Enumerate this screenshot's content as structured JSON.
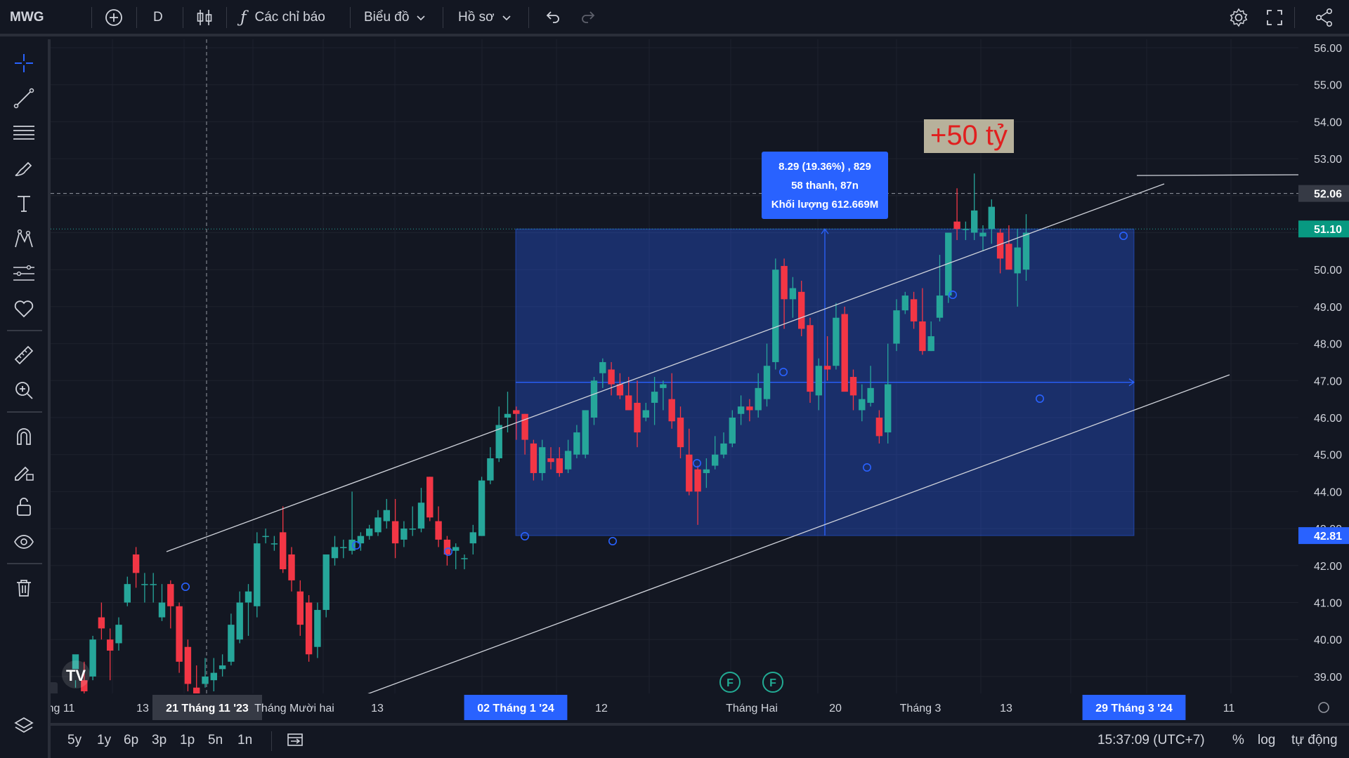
{
  "topbar": {
    "symbol": "MWG",
    "interval": "D",
    "indicators_label": "Các chỉ báo",
    "chart_menu_label": "Biểu đồ",
    "profile_menu_label": "Hồ sơ"
  },
  "chart_data": {
    "type": "candlestick",
    "ylim": [
      38.6,
      56.4
    ],
    "y_ticks": [
      "56.00",
      "55.00",
      "54.00",
      "53.00",
      "52.00",
      "51.00",
      "50.00",
      "49.00",
      "48.00",
      "47.00",
      "46.00",
      "45.00",
      "44.00",
      "43.00",
      "42.00",
      "41.00",
      "40.00",
      "39.00"
    ],
    "price_badges": {
      "crosshair": "52.06",
      "last": "51.10",
      "range_low": "42.81"
    },
    "x_labels": [
      {
        "text": "ng 11",
        "highlight": false
      },
      {
        "text": "13",
        "highlight": false
      },
      {
        "text": "21 Tháng 11 '23",
        "highlight": "gray"
      },
      {
        "text": "Tháng Mười hai",
        "highlight": false
      },
      {
        "text": "13",
        "highlight": false
      },
      {
        "text": "02 Tháng 1 '24",
        "highlight": "blue"
      },
      {
        "text": "12",
        "highlight": false
      },
      {
        "text": "Tháng Hai",
        "highlight": false
      },
      {
        "text": "20",
        "highlight": false
      },
      {
        "text": "Tháng 3",
        "highlight": false
      },
      {
        "text": "13",
        "highlight": false
      },
      {
        "text": "29 Tháng 3 '24",
        "highlight": "blue"
      },
      {
        "text": "11",
        "highlight": false
      }
    ],
    "measure_tooltip": [
      "8.29 (19.36%) , 829",
      "58 thanh, 87n",
      "Khối lượng 612.669M"
    ],
    "annotation_text": "+50 tỷ",
    "events": [
      "F",
      "F"
    ],
    "candles": [
      [
        39.2,
        39.6,
        38.9,
        38.7
      ],
      [
        38.9,
        38.6,
        39.4,
        38.4
      ],
      [
        39.0,
        40.0,
        40.1,
        38.9
      ],
      [
        40.6,
        40.3,
        41.0,
        40.0
      ],
      [
        40.0,
        39.7,
        40.3,
        38.9
      ],
      [
        39.9,
        40.4,
        40.6,
        39.7
      ],
      [
        41.0,
        41.5,
        41.7,
        40.9
      ],
      [
        42.3,
        41.8,
        42.5,
        41.4
      ],
      [
        41.5,
        41.5,
        41.8,
        41.0
      ],
      [
        41.5,
        41.5,
        41.8,
        41.0
      ],
      [
        40.6,
        41.0,
        41.5,
        40.5
      ],
      [
        41.5,
        40.9,
        41.6,
        40.3
      ],
      [
        40.9,
        39.4,
        41.0,
        39.1
      ],
      [
        39.8,
        38.8,
        40.0,
        38.6
      ],
      [
        38.7,
        38.3,
        39.3,
        38.0
      ],
      [
        38.8,
        39.0,
        39.5,
        38.7
      ],
      [
        38.9,
        39.1,
        39.5,
        38.6
      ],
      [
        39.2,
        39.3,
        39.6,
        39.0
      ],
      [
        39.4,
        40.4,
        40.7,
        39.3
      ],
      [
        40.0,
        41.0,
        41.3,
        39.9
      ],
      [
        41.0,
        41.3,
        41.5,
        40.1
      ],
      [
        40.9,
        42.6,
        42.9,
        40.6
      ],
      [
        42.8,
        42.8,
        43.0,
        42.6
      ],
      [
        42.6,
        42.6,
        42.8,
        42.4
      ],
      [
        42.9,
        41.9,
        43.6,
        41.8
      ],
      [
        42.3,
        41.6,
        42.5,
        41.3
      ],
      [
        41.3,
        40.4,
        41.6,
        40.1
      ],
      [
        41.0,
        39.6,
        41.2,
        39.4
      ],
      [
        39.8,
        40.8,
        41.0,
        39.5
      ],
      [
        40.8,
        42.3,
        42.3,
        40.6
      ],
      [
        42.2,
        42.5,
        42.8,
        42.0
      ],
      [
        42.5,
        42.5,
        42.7,
        42.2
      ],
      [
        42.4,
        42.7,
        44.0,
        42.3
      ],
      [
        42.6,
        42.8,
        42.9,
        42.4
      ],
      [
        42.8,
        43.0,
        43.1,
        42.7
      ],
      [
        42.9,
        43.3,
        43.5,
        42.8
      ],
      [
        43.2,
        43.5,
        43.8,
        43.0
      ],
      [
        43.2,
        42.6,
        43.8,
        42.2
      ],
      [
        42.7,
        43.0,
        43.2,
        42.5
      ],
      [
        43.0,
        43.0,
        43.6,
        42.8
      ],
      [
        43.0,
        43.7,
        44.1,
        42.9
      ],
      [
        44.4,
        43.3,
        44.4,
        43.2
      ],
      [
        43.2,
        42.7,
        43.6,
        42.5
      ],
      [
        42.7,
        42.3,
        42.8,
        42.0
      ],
      [
        42.4,
        42.5,
        42.6,
        41.9
      ],
      [
        42.2,
        42.2,
        42.3,
        41.9
      ],
      [
        42.6,
        42.9,
        43.1,
        42.3
      ],
      [
        42.8,
        44.3,
        44.4,
        42.8
      ],
      [
        44.3,
        44.9,
        45.2,
        44.2
      ],
      [
        44.9,
        45.8,
        46.3,
        44.8
      ],
      [
        46.0,
        46.1,
        46.7,
        45.6
      ],
      [
        46.2,
        46.1,
        46.3,
        45.4
      ],
      [
        46.1,
        45.4,
        46.1,
        45.0
      ],
      [
        45.3,
        44.5,
        45.4,
        44.3
      ],
      [
        44.5,
        45.2,
        45.4,
        44.3
      ],
      [
        44.9,
        44.8,
        45.2,
        44.6
      ],
      [
        44.9,
        44.5,
        45.2,
        44.4
      ],
      [
        44.6,
        45.1,
        45.4,
        44.5
      ],
      [
        45.0,
        45.6,
        45.8,
        44.9
      ],
      [
        45.0,
        46.2,
        46.2,
        44.9
      ],
      [
        46.0,
        47.0,
        47.1,
        45.8
      ],
      [
        47.2,
        47.5,
        47.6,
        46.8
      ],
      [
        47.3,
        46.9,
        47.5,
        46.6
      ],
      [
        46.9,
        46.6,
        47.2,
        46.5
      ],
      [
        46.6,
        46.2,
        47.1,
        46.3
      ],
      [
        46.4,
        45.6,
        47.0,
        45.2
      ],
      [
        46.0,
        46.2,
        46.4,
        45.9
      ],
      [
        46.4,
        46.7,
        47.1,
        45.8
      ],
      [
        46.8,
        46.9,
        47.0,
        46.2
      ],
      [
        46.5,
        45.9,
        47.2,
        45.7
      ],
      [
        46.0,
        45.2,
        46.3,
        44.9
      ],
      [
        45.0,
        44.0,
        45.7,
        43.9
      ],
      [
        44.6,
        44.0,
        44.7,
        43.1
      ],
      [
        44.5,
        44.6,
        44.9,
        44.1
      ],
      [
        44.7,
        45.0,
        45.5,
        44.6
      ],
      [
        45.0,
        45.3,
        45.6,
        44.9
      ],
      [
        45.3,
        46.0,
        46.2,
        45.2
      ],
      [
        46.1,
        46.3,
        46.6,
        45.8
      ],
      [
        46.3,
        46.2,
        46.5,
        45.9
      ],
      [
        46.2,
        46.8,
        47.2,
        46.0
      ],
      [
        46.5,
        47.4,
        48.0,
        46.3
      ],
      [
        47.5,
        50.0,
        50.3,
        47.3
      ],
      [
        50.1,
        49.2,
        50.3,
        48.4
      ],
      [
        49.2,
        49.5,
        49.8,
        48.7
      ],
      [
        49.4,
        48.4,
        49.7,
        48.2
      ],
      [
        48.5,
        46.7,
        48.7,
        46.4
      ],
      [
        46.6,
        47.4,
        47.6,
        46.2
      ],
      [
        47.4,
        47.3,
        48.2,
        47.0
      ],
      [
        47.4,
        48.7,
        49.1,
        47.3
      ],
      [
        48.8,
        46.7,
        49.0,
        46.9
      ],
      [
        47.1,
        46.6,
        47.3,
        46.2
      ],
      [
        46.2,
        46.5,
        46.9,
        45.9
      ],
      [
        46.4,
        46.8,
        47.4,
        46.3
      ],
      [
        46.0,
        45.5,
        46.2,
        45.3
      ],
      [
        45.6,
        46.9,
        48.0,
        45.3
      ],
      [
        48.0,
        48.9,
        49.2,
        47.8
      ],
      [
        48.9,
        49.3,
        49.4,
        48.8
      ],
      [
        49.2,
        48.6,
        49.4,
        48.4
      ],
      [
        48.6,
        47.8,
        49.5,
        47.7
      ],
      [
        47.8,
        48.2,
        48.6,
        47.8
      ],
      [
        48.7,
        49.3,
        50.4,
        48.6
      ],
      [
        49.3,
        51.0,
        51.0,
        49.1
      ],
      [
        51.3,
        51.1,
        52.2,
        50.8
      ],
      [
        51.1,
        51.1,
        51.3,
        50.8
      ],
      [
        51.0,
        51.6,
        52.6,
        50.8
      ],
      [
        50.9,
        51.0,
        51.2,
        50.5
      ],
      [
        51.1,
        51.7,
        51.9,
        50.7
      ],
      [
        51.0,
        50.3,
        51.1,
        49.9
      ],
      [
        50.7,
        50.0,
        51.2,
        50.1
      ],
      [
        49.9,
        50.6,
        51.1,
        49.0
      ],
      [
        50.0,
        51.0,
        51.5,
        49.7
      ]
    ]
  }
}
